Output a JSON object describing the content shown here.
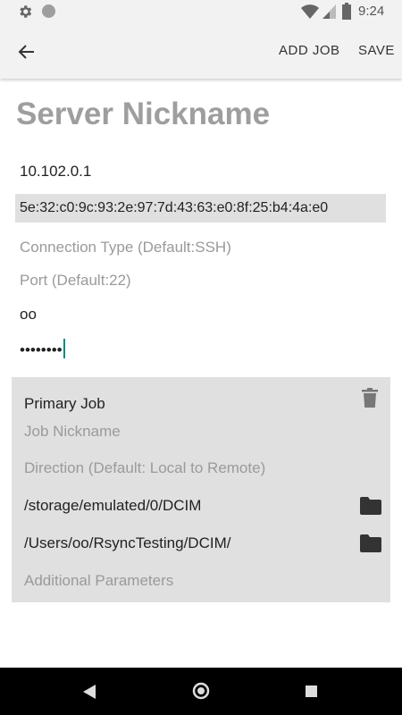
{
  "status_bar": {
    "time": "9:24",
    "icons": [
      "gear-icon",
      "circle-icon",
      "wifi-icon",
      "signal-icon",
      "battery-icon"
    ]
  },
  "app_bar": {
    "back_icon": "arrow-back-icon",
    "add_job_label": "ADD JOB",
    "save_label": "SAVE"
  },
  "server": {
    "nickname_placeholder": "Server Nickname",
    "address": "10.102.0.1",
    "fingerprint": "5e:32:c0:9c:93:2e:97:7d:43:63:e0:8f:25:b4:4a:e0",
    "connection_type_placeholder": "Connection Type (Default:SSH)",
    "port_placeholder": "Port (Default:22)",
    "username": "oo",
    "password_masked": "••••••••"
  },
  "job": {
    "header": "Primary Job",
    "nickname_placeholder": "Job Nickname",
    "direction_placeholder": "Direction (Default: Local to Remote)",
    "local_path": "/storage/emulated/0/DCIM",
    "remote_path": "/Users/oo/RsyncTesting/DCIM/",
    "additional_params_placeholder": "Additional Parameters"
  },
  "colors": {
    "accent": "#00897b",
    "card_bg": "#e0e0e0",
    "placeholder": "#9a9a9a"
  }
}
